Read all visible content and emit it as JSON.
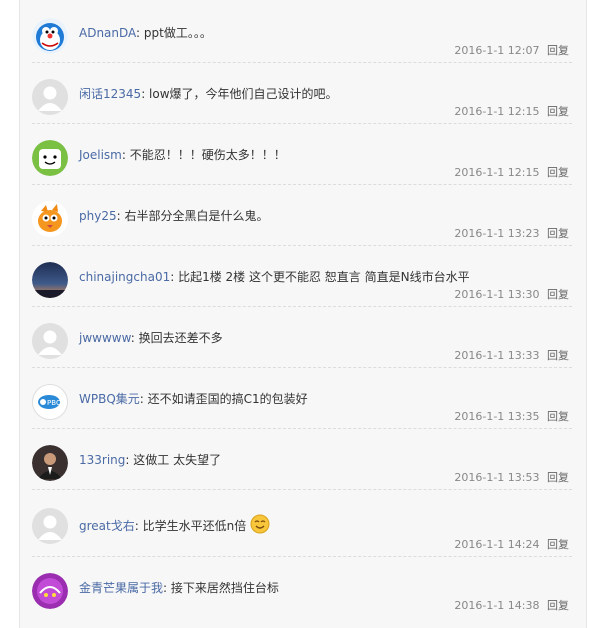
{
  "comments": [
    {
      "user": "ADnanDA",
      "text": "ppt做工。。。",
      "time": "2016-1-1 12:07",
      "reply": "回复",
      "avatar": "doraemon-avatar"
    },
    {
      "user": "闲话12345",
      "text": "low爆了，今年他们自己设计的吧。",
      "time": "2016-1-1 12:15",
      "reply": "回复",
      "avatar": "default-avatar"
    },
    {
      "user": "Joelism",
      "text": "不能忍！！！硬伤太多！！！",
      "time": "2016-1-1 12:15",
      "reply": "回复",
      "avatar": "cartoon-avatar"
    },
    {
      "user": "phy25",
      "text": "右半部分全黑白是什么鬼。",
      "time": "2016-1-1 13:23",
      "reply": "回复",
      "avatar": "bird-avatar"
    },
    {
      "user": "chinajingcha01",
      "text": "比起1楼 2楼 这个更不能忍 恕直言 简直是N线市台水平",
      "time": "2016-1-1 13:30",
      "reply": "回复",
      "avatar": "sunset-avatar"
    },
    {
      "user": "jwwwww",
      "text": "换回去还差不多",
      "time": "2016-1-1 13:33",
      "reply": "回复",
      "avatar": "default-avatar"
    },
    {
      "user": "WPBQ集元",
      "text": "还不如请歪国的搞C1的包装好",
      "time": "2016-1-1 13:35",
      "reply": "回复",
      "avatar": "pbq-logo-avatar"
    },
    {
      "user": "133ring",
      "text": "这做工 太失望了",
      "time": "2016-1-1 13:53",
      "reply": "回复",
      "avatar": "photo-avatar"
    },
    {
      "user": "great戈右",
      "text": "比学生水平还低n倍",
      "time": "2016-1-1 14:24",
      "reply": "回复",
      "avatar": "default-avatar"
    },
    {
      "user": "金青芒果属于我",
      "text": "接下来居然挡住台标",
      "time": "2016-1-1 14:38",
      "reply": "回复",
      "avatar": "purple-avatar"
    }
  ]
}
